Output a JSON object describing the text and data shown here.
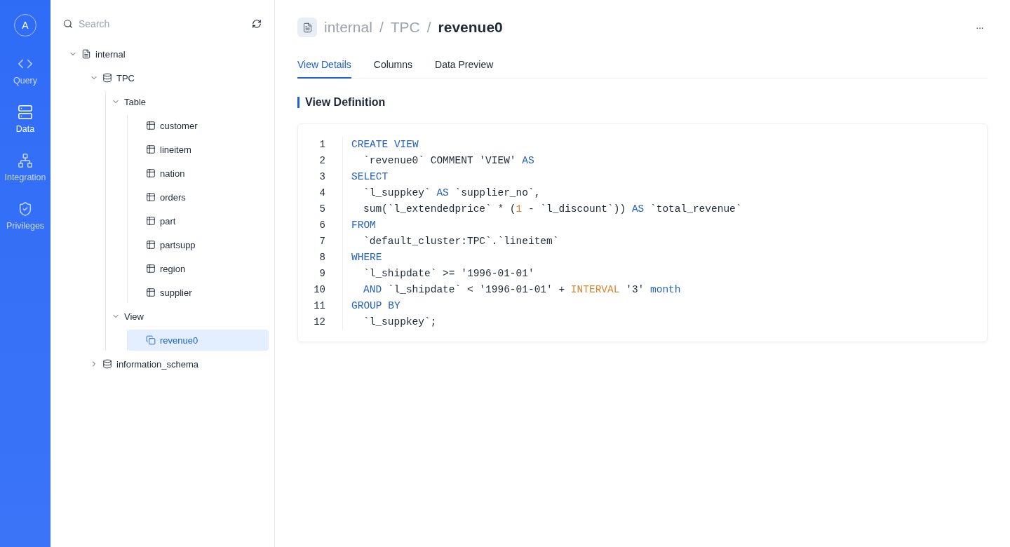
{
  "rail": {
    "avatar": "A",
    "items": [
      {
        "label": "Query",
        "selected": false
      },
      {
        "label": "Data",
        "selected": true
      },
      {
        "label": "Integration",
        "selected": false
      },
      {
        "label": "Privileges",
        "selected": false
      }
    ]
  },
  "explorer": {
    "search": {
      "placeholder": "Search"
    },
    "tree": [
      {
        "label": "internal",
        "kind": "catalog",
        "expanded": true,
        "selected": false,
        "children": [
          {
            "label": "TPC",
            "kind": "database",
            "expanded": true,
            "selected": false,
            "children": [
              {
                "label": "Table",
                "kind": "group",
                "expanded": true,
                "selected": false,
                "children": [
                  {
                    "label": "customer",
                    "kind": "table",
                    "selected": false
                  },
                  {
                    "label": "lineitem",
                    "kind": "table",
                    "selected": false
                  },
                  {
                    "label": "nation",
                    "kind": "table",
                    "selected": false
                  },
                  {
                    "label": "orders",
                    "kind": "table",
                    "selected": false
                  },
                  {
                    "label": "part",
                    "kind": "table",
                    "selected": false
                  },
                  {
                    "label": "partsupp",
                    "kind": "table",
                    "selected": false
                  },
                  {
                    "label": "region",
                    "kind": "table",
                    "selected": false
                  },
                  {
                    "label": "supplier",
                    "kind": "table",
                    "selected": false
                  }
                ]
              },
              {
                "label": "View",
                "kind": "group",
                "expanded": true,
                "selected": false,
                "children": [
                  {
                    "label": "revenue0",
                    "kind": "view",
                    "selected": true
                  }
                ]
              }
            ]
          },
          {
            "label": "information_schema",
            "kind": "database",
            "expanded": false,
            "selected": false
          }
        ]
      }
    ]
  },
  "header": {
    "breadcrumb": [
      "internal",
      "TPC",
      "revenue0"
    ],
    "separator": "/",
    "more": "···"
  },
  "tabs": [
    {
      "label": "View Details",
      "selected": true
    },
    {
      "label": "Columns",
      "selected": false
    },
    {
      "label": "Data Preview",
      "selected": false
    }
  ],
  "section_title": "View Definition",
  "code": [
    {
      "number": "1",
      "indent": false,
      "tokens": [
        {
          "kind": "keyword",
          "text": "CREATE VIEW"
        }
      ]
    },
    {
      "number": "2",
      "indent": true,
      "tokens": [
        {
          "kind": "plain",
          "text": "`revenue0` COMMENT 'VIEW' "
        },
        {
          "kind": "keyword",
          "text": "AS"
        }
      ]
    },
    {
      "number": "3",
      "indent": false,
      "tokens": [
        {
          "kind": "keyword",
          "text": "SELECT"
        }
      ]
    },
    {
      "number": "4",
      "indent": true,
      "tokens": [
        {
          "kind": "plain",
          "text": "`l_suppkey` "
        },
        {
          "kind": "keyword",
          "text": "AS"
        },
        {
          "kind": "plain",
          "text": " `supplier_no`,"
        }
      ]
    },
    {
      "number": "5",
      "indent": true,
      "tokens": [
        {
          "kind": "plain",
          "text": "sum(`l_extendedprice` * ("
        },
        {
          "kind": "literal",
          "text": "1"
        },
        {
          "kind": "plain",
          "text": " - `l_discount`)) "
        },
        {
          "kind": "keyword",
          "text": "AS"
        },
        {
          "kind": "plain",
          "text": " `total_revenue`"
        }
      ]
    },
    {
      "number": "6",
      "indent": false,
      "tokens": [
        {
          "kind": "keyword",
          "text": "FROM"
        }
      ]
    },
    {
      "number": "7",
      "indent": true,
      "tokens": [
        {
          "kind": "plain",
          "text": "`default_cluster:TPC`.`lineitem`"
        }
      ]
    },
    {
      "number": "8",
      "indent": false,
      "tokens": [
        {
          "kind": "keyword",
          "text": "WHERE"
        }
      ]
    },
    {
      "number": "9",
      "indent": true,
      "tokens": [
        {
          "kind": "plain",
          "text": "`l_shipdate` >= '1996-01-01'"
        }
      ]
    },
    {
      "number": "10",
      "indent": true,
      "tokens": [
        {
          "kind": "keyword",
          "text": "AND"
        },
        {
          "kind": "plain",
          "text": " `l_shipdate` < '1996-01-01' + "
        },
        {
          "kind": "literal",
          "text": "INTERVAL"
        },
        {
          "kind": "plain",
          "text": " '3' "
        },
        {
          "kind": "keyword",
          "text": "month"
        }
      ]
    },
    {
      "number": "11",
      "indent": false,
      "tokens": [
        {
          "kind": "keyword",
          "text": "GROUP BY"
        }
      ]
    },
    {
      "number": "12",
      "indent": true,
      "tokens": [
        {
          "kind": "plain",
          "text": "`l_suppkey`;"
        }
      ]
    }
  ]
}
